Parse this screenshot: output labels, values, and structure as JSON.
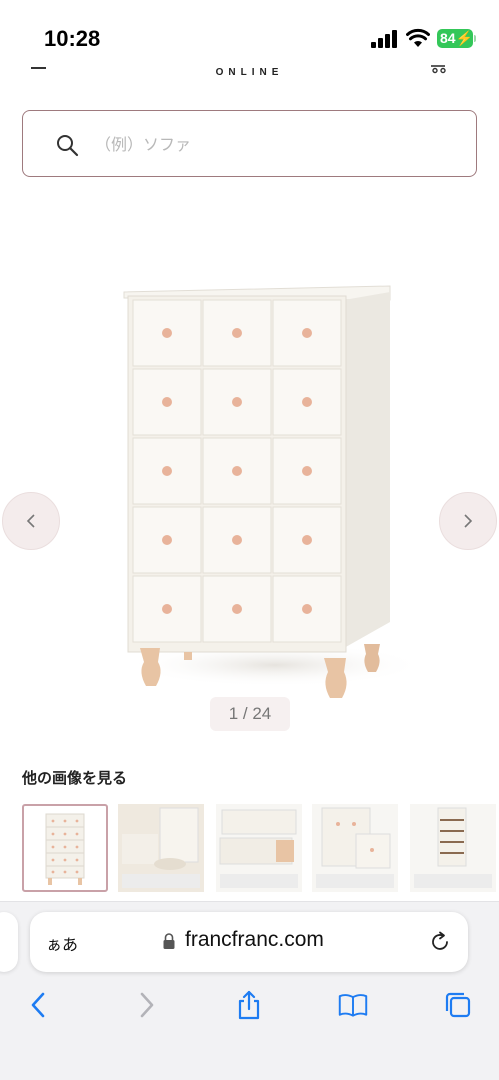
{
  "status_bar": {
    "time": "10:28",
    "battery": "84"
  },
  "header": {
    "brand": "ONLINE"
  },
  "search": {
    "placeholder": "（例）ソファ"
  },
  "gallery": {
    "counter": "1 / 24"
  },
  "thumbnails": {
    "title": "他の画像を見る"
  },
  "browser": {
    "aa": "ぁあ",
    "url": "francfranc.com"
  },
  "colors": {
    "accent": "#9e7a7e",
    "battery": "#34c759",
    "ios_blue": "#1e7cf2",
    "knob": "#e8b39a",
    "dresser": "#f4f1ea"
  },
  "icons": [
    "signal-icon",
    "wifi-icon",
    "menu-icon",
    "cart-icon",
    "search-icon",
    "chevron-left-icon",
    "chevron-right-icon",
    "lock-icon",
    "reload-icon",
    "back-icon",
    "forward-icon",
    "share-icon",
    "bookmarks-icon",
    "tabs-icon"
  ]
}
